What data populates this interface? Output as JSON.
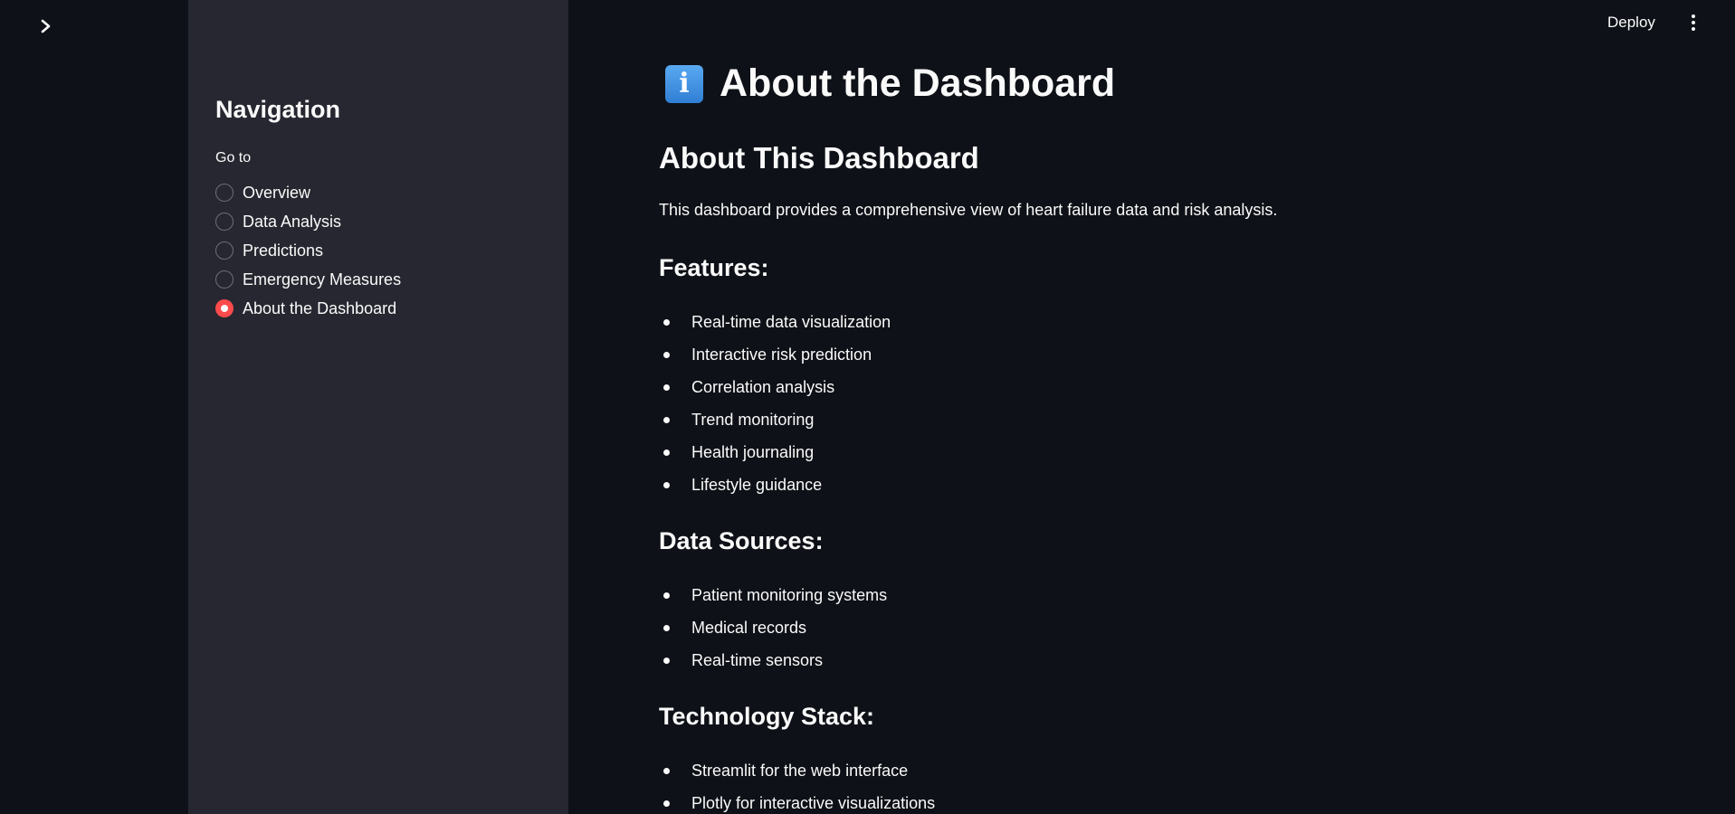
{
  "header": {
    "deploy_label": "Deploy",
    "menu_icon": "more-vertical-icon"
  },
  "rail": {
    "toggle_icon": "chevron-right-icon"
  },
  "sidebar": {
    "title": "Navigation",
    "radio_label": "Go to",
    "options": [
      {
        "label": "Overview",
        "selected": false
      },
      {
        "label": "Data Analysis",
        "selected": false
      },
      {
        "label": "Predictions",
        "selected": false
      },
      {
        "label": "Emergency Measures",
        "selected": false
      },
      {
        "label": "About the Dashboard",
        "selected": true
      }
    ],
    "accent_color": "#ff4b4b"
  },
  "main": {
    "title_icon": "info-icon",
    "title_icon_glyph": "i",
    "title": "About the Dashboard",
    "heading": "About This Dashboard",
    "intro": "This dashboard provides a comprehensive view of heart failure data and risk analysis.",
    "features": {
      "heading": "Features:",
      "items": [
        "Real-time data visualization",
        "Interactive risk prediction",
        "Correlation analysis",
        "Trend monitoring",
        "Health journaling",
        "Lifestyle guidance"
      ]
    },
    "data_sources": {
      "heading": "Data Sources:",
      "items": [
        "Patient monitoring systems",
        "Medical records",
        "Real-time sensors"
      ]
    },
    "tech_stack": {
      "heading": "Technology Stack:",
      "items": [
        "Streamlit for the web interface",
        "Plotly for interactive visualizations"
      ]
    }
  },
  "colors": {
    "background": "#0e1117",
    "sidebar": "#262730",
    "text": "#fafafa"
  }
}
